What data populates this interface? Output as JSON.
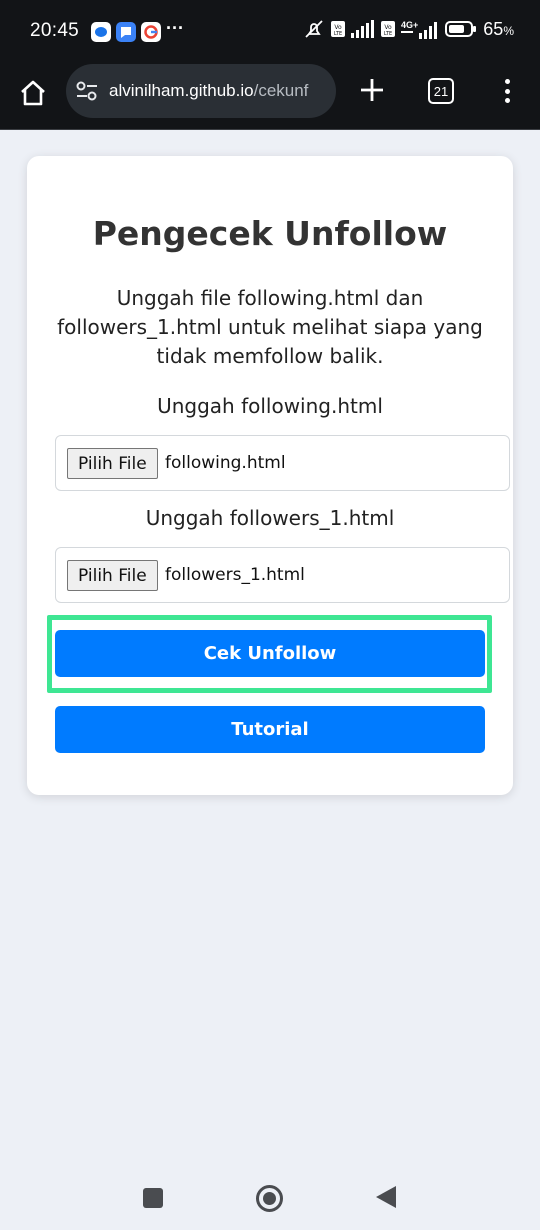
{
  "status_bar": {
    "time": "20:45",
    "more_glyph": "···",
    "battery_percent": "65",
    "battery_unit": "%",
    "network_label": "4G+",
    "volte_label": "Vo LTE",
    "icons": [
      "messages-icon",
      "chat-icon",
      "google-icon",
      "mute-icon",
      "signal-icon",
      "battery-icon"
    ]
  },
  "browser": {
    "url_host": "alvinilham.github.io",
    "url_path": "/cekunf",
    "tab_count": "21",
    "icons": [
      "home-icon",
      "site-settings-icon",
      "new-tab-icon",
      "tab-switcher-icon",
      "menu-icon"
    ]
  },
  "page": {
    "title": "Pengecek Unfollow",
    "description": "Unggah file following.html dan followers_1.html untuk melihat siapa yang tidak memfollow balik.",
    "following_label": "Unggah following.html",
    "following_button": "Pilih File",
    "following_file": "following.html",
    "followers_label": "Unggah followers_1.html",
    "followers_button": "Pilih File",
    "followers_file": "followers_1.html",
    "check_button": "Cek Unfollow",
    "tutorial_button": "Tutorial"
  },
  "colors": {
    "primary_button": "#007bff",
    "highlight": "#3ee693",
    "status_bar": "#121417",
    "page_bg": "#edf0f6"
  }
}
